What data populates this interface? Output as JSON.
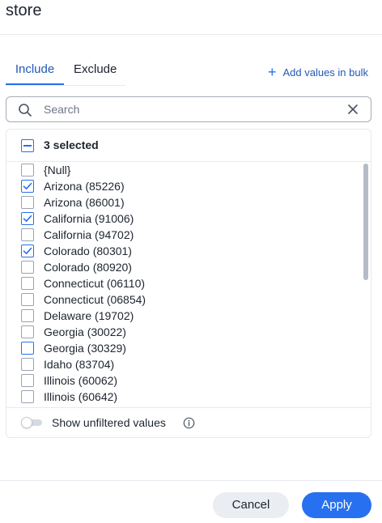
{
  "header": {
    "title": "store"
  },
  "tabs": [
    {
      "label": "Include",
      "active": true
    },
    {
      "label": "Exclude",
      "active": false
    }
  ],
  "bulk": {
    "label": "Add values in bulk",
    "icon": "plus-icon"
  },
  "search": {
    "placeholder": "Search",
    "value": ""
  },
  "selection": {
    "label": "3 selected",
    "state": "partial"
  },
  "items": [
    {
      "label": "{Null}",
      "checked": false,
      "focused": false
    },
    {
      "label": "Arizona (85226)",
      "checked": true,
      "focused": false
    },
    {
      "label": "Arizona (86001)",
      "checked": false,
      "focused": false
    },
    {
      "label": "California (91006)",
      "checked": true,
      "focused": false
    },
    {
      "label": "California (94702)",
      "checked": false,
      "focused": false
    },
    {
      "label": "Colorado (80301)",
      "checked": true,
      "focused": false
    },
    {
      "label": "Colorado (80920)",
      "checked": false,
      "focused": false
    },
    {
      "label": "Connecticut (06110)",
      "checked": false,
      "focused": false
    },
    {
      "label": "Connecticut (06854)",
      "checked": false,
      "focused": false
    },
    {
      "label": "Delaware (19702)",
      "checked": false,
      "focused": false
    },
    {
      "label": "Georgia (30022)",
      "checked": false,
      "focused": false
    },
    {
      "label": "Georgia (30329)",
      "checked": false,
      "focused": true
    },
    {
      "label": "Idaho (83704)",
      "checked": false,
      "focused": false
    },
    {
      "label": "Illinois (60062)",
      "checked": false,
      "focused": false
    },
    {
      "label": "Illinois (60642)",
      "checked": false,
      "focused": false
    }
  ],
  "unfiltered": {
    "label": "Show unfiltered values",
    "enabled": false
  },
  "buttons": {
    "cancel": "Cancel",
    "apply": "Apply"
  },
  "colors": {
    "accent": "#2770ef",
    "accent_text": "#2359b3",
    "border": "#e6e9ef"
  }
}
